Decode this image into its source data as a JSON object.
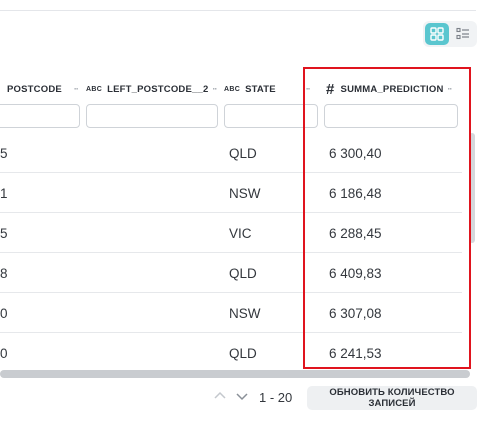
{
  "view_toggle": {
    "active": "grid",
    "accent": "#5ac6cf"
  },
  "columns": [
    {
      "key": "postcode",
      "type_tag": "",
      "label": "POSTCODE"
    },
    {
      "key": "left_postcode",
      "type_tag": "ABC",
      "label": "LEFT_POSTCODE__2"
    },
    {
      "key": "state",
      "type_tag": "ABC",
      "label": "STATE"
    },
    {
      "key": "summa",
      "type_tag": "#",
      "label": "SUMMA_PREDICTION"
    }
  ],
  "rows": [
    {
      "postcode": "5",
      "left_postcode": "",
      "state": "QLD",
      "summa": "6 300,40"
    },
    {
      "postcode": "1",
      "left_postcode": "",
      "state": "NSW",
      "summa": "6 186,48"
    },
    {
      "postcode": "5",
      "left_postcode": "",
      "state": "VIC",
      "summa": "6 288,45"
    },
    {
      "postcode": "8",
      "left_postcode": "",
      "state": "QLD",
      "summa": "6 409,83"
    },
    {
      "postcode": "0",
      "left_postcode": "",
      "state": "NSW",
      "summa": "6 307,08"
    },
    {
      "postcode": "0",
      "left_postcode": "",
      "state": "QLD",
      "summa": "6 241,53"
    }
  ],
  "footer": {
    "range": "1 - 20",
    "refresh_label": "ОБНОВИТЬ КОЛИЧЕСТВО ЗАПИСЕЙ"
  },
  "highlight_color": "#e0141e"
}
